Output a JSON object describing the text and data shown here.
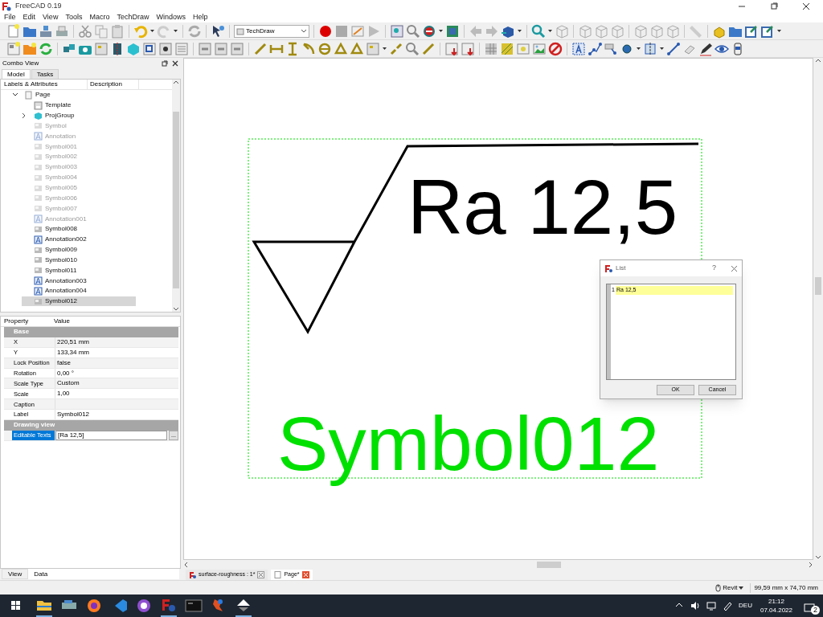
{
  "window": {
    "title": "FreeCAD 0.19"
  },
  "menu": [
    "File",
    "Edit",
    "View",
    "Tools",
    "Macro",
    "TechDraw",
    "Windows",
    "Help"
  ],
  "workbench": "TechDraw",
  "combo_view": {
    "title": "Combo View",
    "tabs": [
      {
        "label": "Model",
        "selected": true
      },
      {
        "label": "Tasks",
        "selected": false
      }
    ],
    "tree": {
      "columns": [
        "Labels & Attributes",
        "Description"
      ],
      "items": [
        {
          "label": "Page",
          "kind": "page",
          "expanded": true,
          "children": [
            {
              "label": "Template",
              "kind": "template",
              "hidden": false,
              "collapsed": false,
              "selected": false
            },
            {
              "label": "ProjGroup",
              "kind": "group",
              "hidden": false,
              "collapsed": true,
              "selected": false
            },
            {
              "label": "Symbol",
              "kind": "symbol",
              "hidden": true,
              "collapsed": false,
              "selected": false
            },
            {
              "label": "Annotation",
              "kind": "annotation",
              "hidden": true,
              "collapsed": false,
              "selected": false
            },
            {
              "label": "Symbol001",
              "kind": "symbol",
              "hidden": true,
              "collapsed": false,
              "selected": false
            },
            {
              "label": "Symbol002",
              "kind": "symbol",
              "hidden": true,
              "collapsed": false,
              "selected": false
            },
            {
              "label": "Symbol003",
              "kind": "symbol",
              "hidden": true,
              "collapsed": false,
              "selected": false
            },
            {
              "label": "Symbol004",
              "kind": "symbol",
              "hidden": true,
              "collapsed": false,
              "selected": false
            },
            {
              "label": "Symbol005",
              "kind": "symbol",
              "hidden": true,
              "collapsed": false,
              "selected": false
            },
            {
              "label": "Symbol006",
              "kind": "symbol",
              "hidden": true,
              "collapsed": false,
              "selected": false
            },
            {
              "label": "Symbol007",
              "kind": "symbol",
              "hidden": true,
              "collapsed": false,
              "selected": false
            },
            {
              "label": "Annotation001",
              "kind": "annotation",
              "hidden": true,
              "collapsed": false,
              "selected": false
            },
            {
              "label": "Symbol008",
              "kind": "symbol",
              "hidden": false,
              "collapsed": false,
              "selected": false
            },
            {
              "label": "Annotation002",
              "kind": "annotation",
              "hidden": false,
              "collapsed": false,
              "selected": false
            },
            {
              "label": "Symbol009",
              "kind": "symbol",
              "hidden": false,
              "collapsed": false,
              "selected": false
            },
            {
              "label": "Symbol010",
              "kind": "symbol",
              "hidden": false,
              "collapsed": false,
              "selected": false
            },
            {
              "label": "Symbol011",
              "kind": "symbol",
              "hidden": false,
              "collapsed": false,
              "selected": false
            },
            {
              "label": "Annotation003",
              "kind": "annotation",
              "hidden": false,
              "collapsed": false,
              "selected": false
            },
            {
              "label": "Annotation004",
              "kind": "annotation",
              "hidden": false,
              "collapsed": false,
              "selected": false
            },
            {
              "label": "Symbol012",
              "kind": "symbol",
              "hidden": false,
              "collapsed": false,
              "selected": true
            }
          ]
        }
      ]
    }
  },
  "properties": {
    "columns": [
      "Property",
      "Value"
    ],
    "groups": [
      {
        "name": "Base",
        "rows": [
          {
            "name": "X",
            "value": "220,51 mm",
            "selected": false
          },
          {
            "name": "Y",
            "value": "133,34 mm",
            "selected": false
          },
          {
            "name": "Lock Position",
            "value": "false",
            "selected": false
          },
          {
            "name": "Rotation",
            "value": "0,00 °",
            "selected": false
          },
          {
            "name": "Scale Type",
            "value": "Custom",
            "selected": false
          },
          {
            "name": "Scale",
            "value": "1,00",
            "selected": false
          },
          {
            "name": "Caption",
            "selected": false
          },
          {
            "name": "Label",
            "value": "Symbol012",
            "selected": false
          }
        ]
      },
      {
        "name": "Drawing view",
        "rows": [
          {
            "name": "Editable Texts",
            "value": "[Ra 12,5]",
            "selected": true,
            "button": "..."
          }
        ]
      }
    ]
  },
  "panel_tabs": [
    {
      "label": "View",
      "selected": false
    },
    {
      "label": "Data",
      "selected": true
    }
  ],
  "drawing": {
    "symbol_text": "Ra 12,5",
    "label": "Symbol012"
  },
  "dialog": {
    "title": "List",
    "help": "?",
    "items": [
      {
        "number": "1",
        "text": "Ra 12,5",
        "selected": true
      }
    ],
    "buttons": [
      "OK",
      "Cancel"
    ]
  },
  "doc_tabs": [
    {
      "label": "surface-roughness : 1*",
      "kind": "document",
      "selected": false
    },
    {
      "label": "Page*",
      "kind": "page",
      "selected": true
    }
  ],
  "status_bar": {
    "navigation": "Revit",
    "dimensions": "99,59 mm x 74,70 mm"
  },
  "taskbar": {
    "language": "DEU",
    "time": "21:12",
    "date": "07.04.2022",
    "notifications": "2"
  }
}
